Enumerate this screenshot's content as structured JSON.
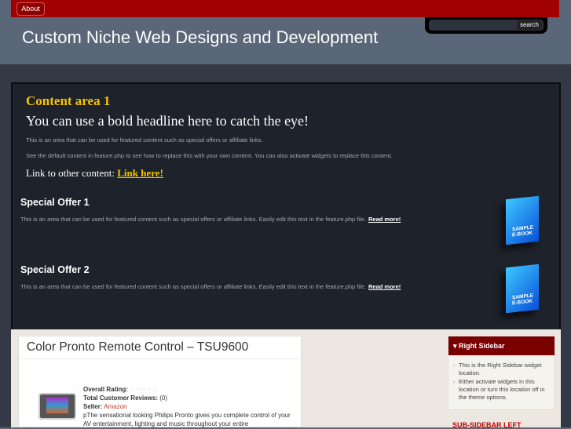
{
  "nav": {
    "about": "About"
  },
  "search": {
    "button": "search",
    "value": ""
  },
  "site_title": "Custom Niche Web Designs and Development",
  "feature": {
    "title": "Content area 1",
    "headline": "You can use a bold headline here to catch the eye!",
    "para1": "This is an area that can be used for featured content such as special offers or affiliate links.",
    "para2": "See the default content in feature.php to see how to replace this with your own content. You can also activate widgets to replace this content.",
    "link_prefix": "Link to other content:",
    "link_label": "Link here!",
    "offers": [
      {
        "title": "Special Offer 1",
        "text": "This is an area that can be used for featured content such as special offers or affiliate links. Easily edit this text in the feature.php file.",
        "read_more": "Read more!",
        "book_label": "SAMPLE E-BOOK"
      },
      {
        "title": "Special Offer 2",
        "text": "This is an area that can be used for featured content such as special offers or affiliate links. Easily edit this text in the feature.php file.",
        "read_more": "Read more!",
        "book_label": "SAMPLE E-BOOK"
      }
    ]
  },
  "post": {
    "title": "Color Pronto Remote Control – TSU9600",
    "rating_label": "Overall Rating:",
    "rating_value": 0,
    "reviews_label": "Total Customer Reviews:",
    "reviews_value": "(0)",
    "seller_label": "Seller:",
    "seller_value": "Amazon",
    "description": "pThe sensational looking Philips Pronto gives you complete control of your AV entertainment, lighting and music throughout your entire"
  },
  "sidebar": {
    "title": "Right Sidebar",
    "items": [
      "This is the Right Sidebar widget location.",
      "Either activate widgets in this location or turn this location off in the theme options."
    ],
    "sub_title": "SUB-SIDEBAR LEFT"
  }
}
